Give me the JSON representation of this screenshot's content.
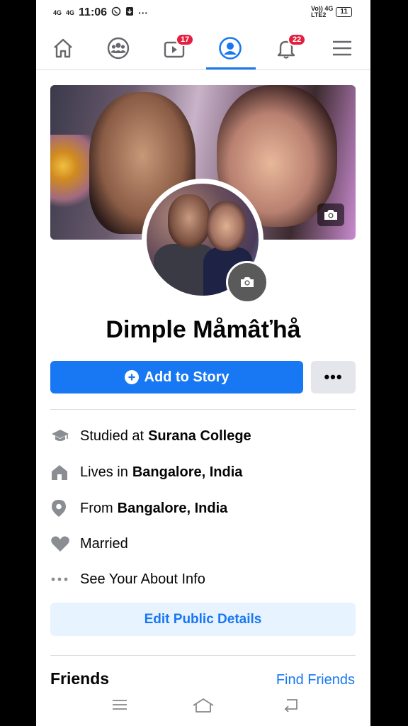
{
  "status": {
    "signal1": "4G",
    "signal2": "4G",
    "time": "11:06",
    "right_label": "Vo)) 4G",
    "right_sub": "LTE2",
    "battery": "11"
  },
  "nav": {
    "home": "home-icon",
    "groups": "groups-icon",
    "watch_badge": "17",
    "profile": "profile-icon",
    "notifications_badge": "22",
    "menu": "menu-icon",
    "active_color": "#1877f2",
    "badge_color": "#e41e3f"
  },
  "profile": {
    "name": "Dimple Måmâťhå",
    "add_story": "Add to Story",
    "more": "•••"
  },
  "about": [
    {
      "icon": "graduation-cap-icon",
      "prefix": "Studied at",
      "value": "Surana College"
    },
    {
      "icon": "house-icon",
      "prefix": "Lives in",
      "value": "Bangalore, India"
    },
    {
      "icon": "location-pin-icon",
      "prefix": "From",
      "value": "Bangalore, India"
    },
    {
      "icon": "heart-icon",
      "prefix": "Married",
      "value": ""
    },
    {
      "icon": "ellipsis-icon",
      "prefix": "See Your About Info",
      "value": ""
    }
  ],
  "edit_public_details": "Edit Public Details",
  "friends": {
    "title": "Friends",
    "find": "Find Friends"
  }
}
